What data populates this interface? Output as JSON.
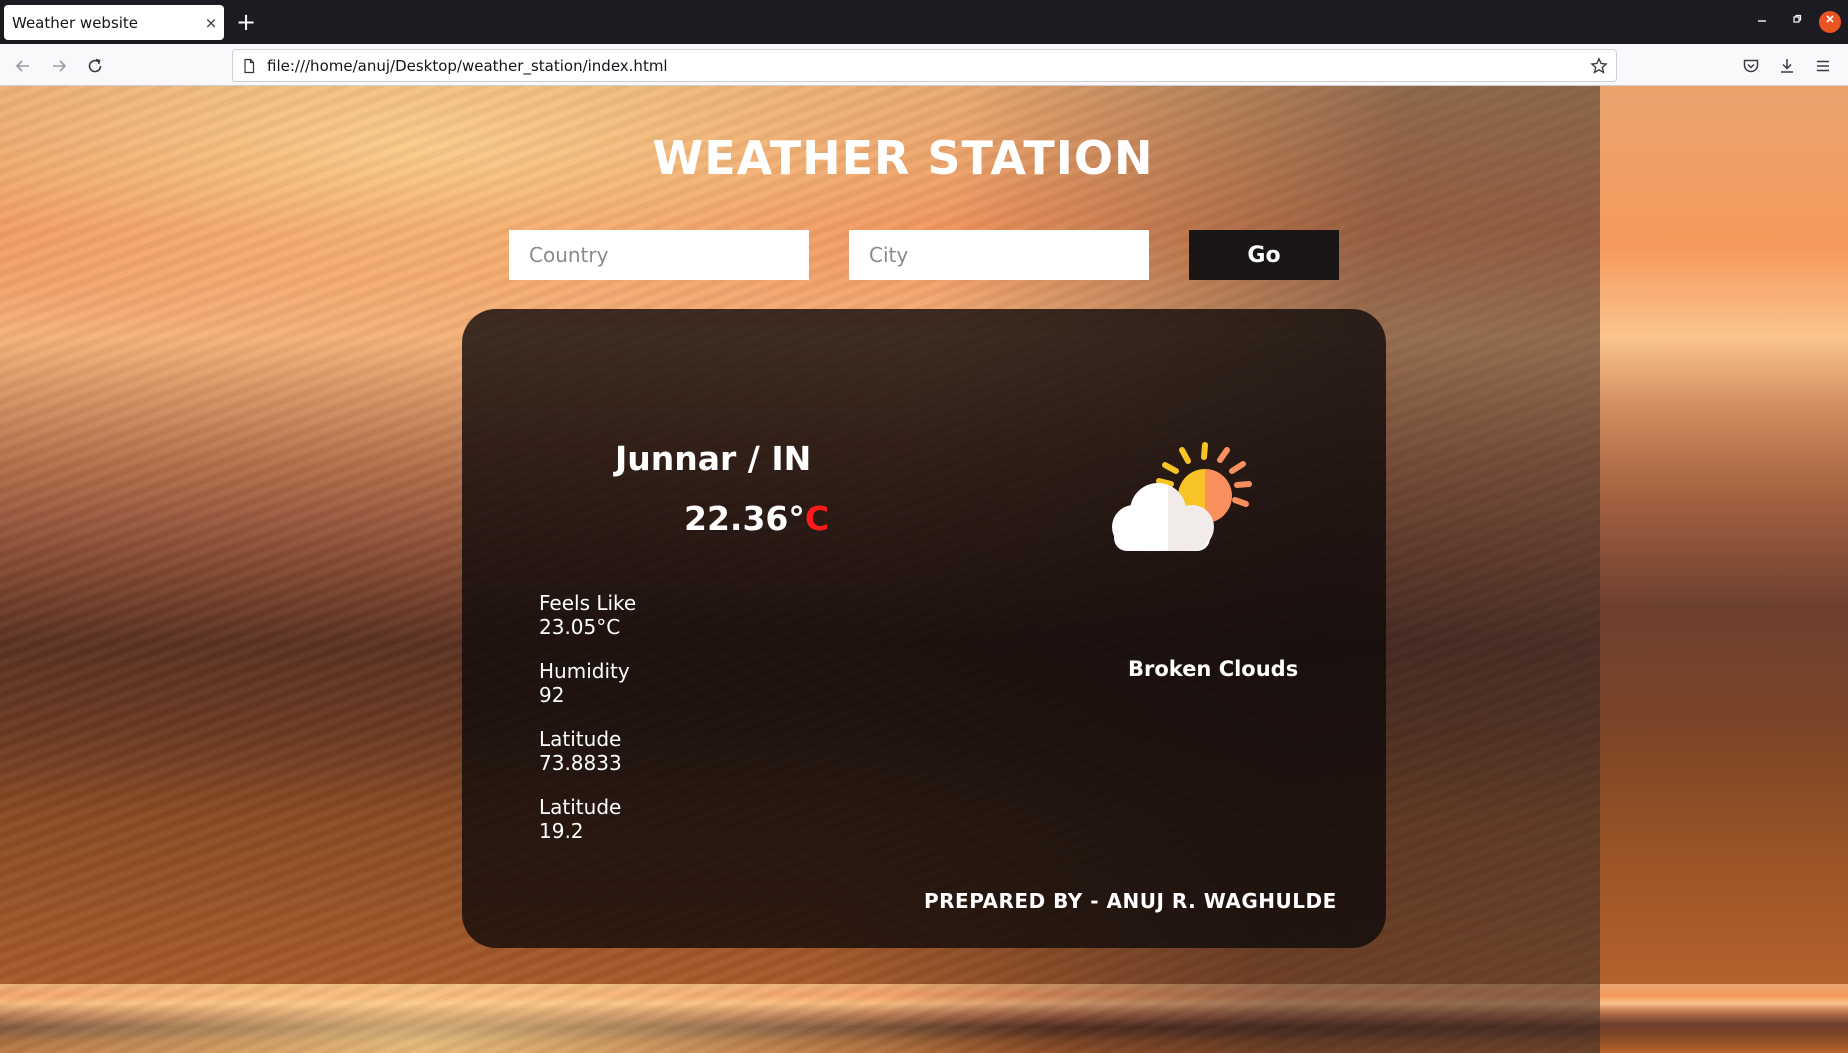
{
  "browser": {
    "tab_title": "Weather website",
    "tab_close": "×",
    "new_tab": "+",
    "url": "file:///home/anuj/Desktop/weather_station/index.html"
  },
  "page": {
    "title": "WEATHER STATION",
    "country_placeholder": "Country",
    "city_placeholder": "City",
    "go_label": "Go"
  },
  "weather": {
    "location": "Junnar / IN",
    "temperature": "22.36°",
    "temperature_unit": "C",
    "feels_like_label": "Feels Like",
    "feels_like_value": "23.05°C",
    "humidity_label": "Humidity",
    "humidity_value": "92",
    "lat1_label": "Latitude",
    "lat1_value": "73.8833",
    "lat2_label": "Latitude",
    "lat2_value": "19.2",
    "description": "Broken Clouds",
    "icon": "partly-cloudy-icon"
  },
  "credit": "PREPARED BY - ANUJ R. WAGHULDE",
  "colors": {
    "accent_temp_unit": "#ff1a1a",
    "button_bg": "#1a1616",
    "sun_yellow": "#f7c325",
    "sun_orange": "#f98f5c"
  }
}
